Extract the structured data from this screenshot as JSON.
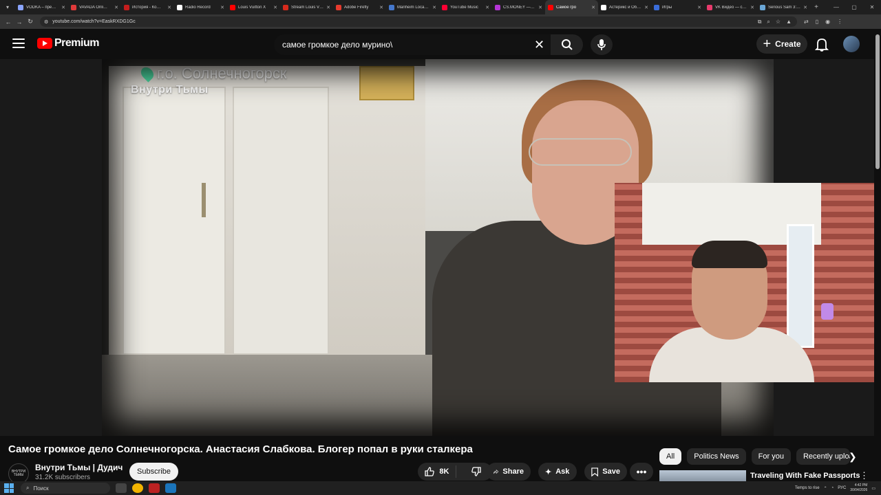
{
  "browser": {
    "tabs": [
      {
        "label": "VODKA – пре…",
        "color": "#8aa4ff"
      },
      {
        "label": "VAVADA Onli…",
        "color": "#e03a3a"
      },
      {
        "label": "История - Ко…",
        "color": "#c41d1d"
      },
      {
        "label": "Radio Record",
        "color": "#ffffff"
      },
      {
        "label": "Louis Vuitton X",
        "color": "#ff0000"
      },
      {
        "label": "Stream Louis V…",
        "color": "#d62a1c"
      },
      {
        "label": "Adobe Firefly",
        "color": "#e63b2e"
      },
      {
        "label": "Manheim Loca…",
        "color": "#4477cc"
      },
      {
        "label": "YouTube Music",
        "color": "#ff0033"
      },
      {
        "label": "CS.MONEY —…",
        "color": "#b535d6"
      },
      {
        "label": "Самое гро",
        "color": "#ff0000",
        "active": true
      },
      {
        "label": "Астерикс и Об…",
        "color": "#ffffff"
      },
      {
        "label": "Игры",
        "color": "#3a6cd8"
      },
      {
        "label": "VK Видео — с…",
        "color": "#e83a6c"
      },
      {
        "label": "Serious Sam 3:…",
        "color": "#6aa6d6"
      }
    ],
    "url": "youtube.com/watch?v=EaskRXDG1Gc"
  },
  "header": {
    "logo_text": "Premium",
    "search_value": "самое громкое дело мурино\\",
    "create_label": "Create"
  },
  "video_overlay": {
    "city": "г.о. Солнечногорск",
    "brand": "Внутри Тьмы"
  },
  "video": {
    "title": "Самое громкое дело Солнечногорска. Анастасия Слабкова. Блогер попал в руки сталкера",
    "channel_name": "Внутри Тьмы | Дудич",
    "channel_avatar_text": "ВНУТРИ ТЬМЫ",
    "subscribers": "31.2K subscribers",
    "subscribe_label": "Subscribe",
    "likes": "8K",
    "share_label": "Share",
    "ask_label": "Ask",
    "save_label": "Save"
  },
  "chips": [
    {
      "label": "All",
      "active": true
    },
    {
      "label": "Politics News"
    },
    {
      "label": "For you"
    },
    {
      "label": "Recently uploaded"
    }
  ],
  "recommendation": {
    "title": "Traveling With Fake Passports"
  },
  "taskbar": {
    "search_label": "Поиск",
    "weather": "Temps to rise",
    "lang": "РУС",
    "time": "4:42 PM",
    "date": "30/04/2026"
  },
  "icons": {
    "menu": "hamburger-icon",
    "search": "search-icon",
    "mic": "mic-icon",
    "bell": "bell-icon",
    "like": "thumbs-up-icon",
    "dislike": "thumbs-down-icon",
    "share": "share-icon",
    "ask": "sparkle-icon",
    "save": "bookmark-icon"
  }
}
